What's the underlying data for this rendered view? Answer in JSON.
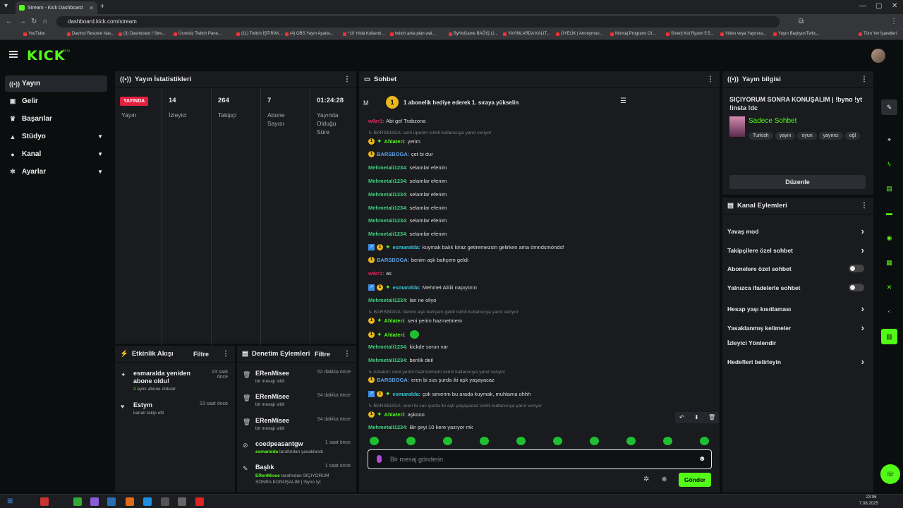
{
  "browser": {
    "tab_title": "Stream - Kick Dashboard",
    "url": "dashboard.kick.com/stream",
    "bookmarks": [
      "YouTube",
      "Davinci Resolve Nas...",
      "(3) Dashboard / Stre...",
      "Ücretsiz Twitch Pane...",
      "(11) Twitch İŞTIRAK...",
      "(4) OBS Yayın Ayarla...",
      "*10 Yılda Kullandı...",
      "twitch arka plan wal...",
      "ByNoGame BAĞIŞ Lİ...",
      "YAYINLARDA KALIT...",
      "ÜYELİK | Anonymou...",
      "Montaj Programı Ol...",
      "Sinerji Koi Ryzen 5 5...",
      "Video veya Yayınıra...",
      "Yayın Başlıyor/Twitc...",
      "Tüm Yer İşaretleri"
    ]
  },
  "nav": {
    "items": [
      {
        "label": "Yayın"
      },
      {
        "label": "Gelir"
      },
      {
        "label": "Başarılar"
      },
      {
        "label": "Stüdyo"
      },
      {
        "label": "Kanal"
      },
      {
        "label": "Ayarlar"
      }
    ]
  },
  "stats": {
    "title": "Yayın İstatistikleri",
    "live_badge": "YAYINDA",
    "live_label": "Yayın",
    "cols": [
      {
        "value": "14",
        "label": "İzleyici"
      },
      {
        "value": "264",
        "label": "Takipçi"
      },
      {
        "value": "7",
        "label": "Abone Sayısı"
      },
      {
        "value": "01:24:28",
        "label": "Yayında Olduğu Süre"
      }
    ]
  },
  "activity": {
    "title": "Etkinlik Akışı",
    "filter": "Filtre",
    "items": [
      {
        "title": "esmaralda yeniden abone oldu!",
        "sub_highlight": "2",
        "sub": " aylık abone oldular",
        "time": "23 saat önce"
      },
      {
        "title": "Estym",
        "sub": "kanalı takip etti",
        "time": "23 saat önce"
      }
    ]
  },
  "moderation": {
    "title": "Denetim Eylemleri",
    "filter": "Filtre",
    "items": [
      {
        "title": "ERenMisee",
        "sub": "bir mesajı sildi",
        "time": "52 dakika önce"
      },
      {
        "title": "ERenMisee",
        "sub": "bir mesajı sildi",
        "time": "54 dakika önce"
      },
      {
        "title": "ERenMisee",
        "sub": "bir mesajı sildi",
        "time": "54 dakika önce"
      },
      {
        "title": "coedpeasantgw",
        "sub_user": "esmaralda",
        "sub": " tarafından yasaklandı",
        "time": "1 saat önce"
      },
      {
        "title": "Başlık",
        "sub_user": "ERenMisee",
        "sub": " tarafından SIÇIYORUM SONRA KONUŞALIM | !byno !yt",
        "time": "1 saat önce"
      }
    ]
  },
  "chat": {
    "title": "Sohbet",
    "pinned_rank": "1",
    "pinned": "1 abonelik hediye ederek 1. sıraya yükselin",
    "pinned_avatar": "M",
    "messages": [
      {
        "user": "w8rr1",
        "text": "Abi gel Trabzona"
      },
      {
        "reply": "↳ BARSBOGA: seni üperim isimli kullanıcıya yanıt veriyor"
      },
      {
        "user": "Ahlateri",
        "text": "yerim"
      },
      {
        "user": "BARSBOGA",
        "text": "çet bi dur"
      },
      {
        "user": "Mehmetali1234",
        "text": "selamlar efenim"
      },
      {
        "user": "Mehmetali1234",
        "text": "selamlar efenim"
      },
      {
        "user": "Mehmetali1234",
        "text": "selamlar efenim"
      },
      {
        "user": "Mehmetali1234",
        "text": "selamlar efenim"
      },
      {
        "user": "Mehmetali1234",
        "text": "selamlar efenim"
      },
      {
        "user": "Mehmetali1234",
        "text": "selamlar efenim"
      },
      {
        "user": "esmaralda",
        "text": "kuymak balık kiraz getiremezsin gelirken ama ömndsmöndsf"
      },
      {
        "user": "BARSBOGA",
        "text": "benim aşk bahçem geldi"
      },
      {
        "user": "w8rr1",
        "text": "as"
      },
      {
        "user": "esmaralda",
        "text": "Mehmet Aliiiii napıyorın"
      },
      {
        "user": "Mehmetali1234",
        "text": "lan ne oliyo"
      },
      {
        "reply": "↳ BARSBOGA: benim aşk bahçem geldi isimli kullanıcıya yanıt veriyor"
      },
      {
        "user": "Ahlateri",
        "text": "seni yerim hazmetmem"
      },
      {
        "user": "Ahlateri",
        "text": ""
      },
      {
        "user": "Mehmetali1234",
        "text": "kickde sorun var"
      },
      {
        "user": "Mehmetali1234",
        "text": "benlik deil"
      },
      {
        "reply": "↳ Ahlateri: seni yerim hazmetmem isimli kullanıcıya yanıt veriyor"
      },
      {
        "user": "BARSBOGA",
        "text": "eren bi sus şurda iki aşk yaşayacaz"
      },
      {
        "user": "esmaralda",
        "text": "çok severim bu arada kuymak, muhlama ohhh"
      },
      {
        "reply": "↳ BARSBOGA: eren bi sus şurda iki aşk yaşayacaz isimli kullanıcıya yanıt veriyor"
      },
      {
        "user": "Ahlateri",
        "text": "aşkooo"
      },
      {
        "user": "Mehmetali1234",
        "text": "Bir şeyi 10 kere yazıyor mk"
      }
    ],
    "input_placeholder": "Bir mesaj gönderin",
    "send": "Gönder"
  },
  "info": {
    "title": "Yayın bilgisi",
    "stream_title": "SIÇIYORUM SONRA KONUŞALIM | !byno !yt !insta !dc",
    "category": "Sadece Sohbet",
    "tags": [
      "Turkish",
      "yayın",
      "oyun",
      "yayıncı",
      "eğl"
    ],
    "edit": "Düzenle"
  },
  "channel_actions": {
    "title": "Kanal Eylemleri",
    "items": [
      {
        "label": "Yavaş mod",
        "kind": "chevron"
      },
      {
        "label": "Takipçilere özel sohbet",
        "kind": "chevron"
      },
      {
        "label": "Abonelere özel sohbet",
        "kind": "toggle"
      },
      {
        "label": "Yalnızca ifadelerle sohbet",
        "kind": "toggle"
      },
      {
        "label": "Hesap yaşı kısıtlaması",
        "kind": "chevron"
      },
      {
        "label": "Yasaklanmış kelimeler",
        "kind": "chevron"
      },
      {
        "label": "İzleyici Yönlendir",
        "kind": "none"
      },
      {
        "label": "Hedefleri belirleyin",
        "kind": "chevron"
      }
    ]
  },
  "taskbar": {
    "time": "23:06",
    "date": "7.08.2025"
  },
  "colors": {
    "brand": "#53fc18",
    "live": "#e2203f",
    "mehmet": "#3fd07f",
    "barsboga": "#5aa2e8",
    "ahlateri": "#53fc18",
    "esmaralda": "#33c8d4",
    "w8rr1": "#e8265f"
  }
}
